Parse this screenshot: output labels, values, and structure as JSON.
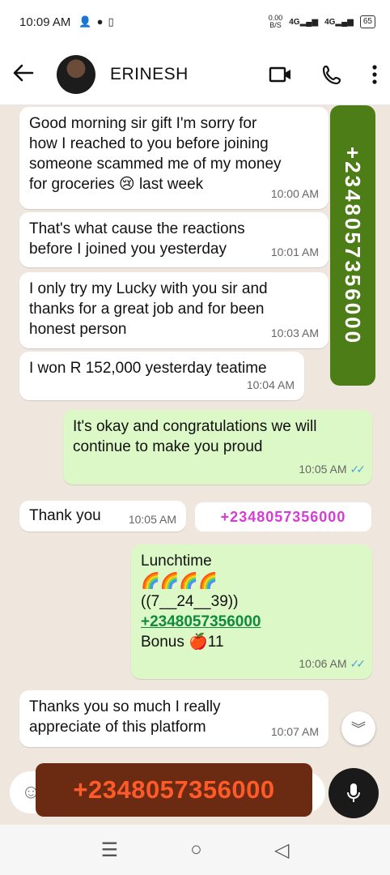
{
  "status_bar": {
    "time": "10:09 AM",
    "net_speed_value": "0.00",
    "net_speed_unit": "B/S",
    "signal1": "4G",
    "signal2": "4G",
    "battery": "65"
  },
  "header": {
    "contact_name": "ERINESH"
  },
  "messages": [
    {
      "dir": "in",
      "text": "Good morning sir gift I'm sorry for\nhow I reached to you before  joining\nsomeone scammed me of my money\nfor groceries 😢 last week",
      "time": "10:00 AM"
    },
    {
      "dir": "in",
      "text": "That's what cause the reactions\nbefore I joined you yesterday",
      "time": "10:01 AM"
    },
    {
      "dir": "in",
      "text": "I only try my Lucky with you sir and\nthanks for a great job and for been\nhonest person",
      "time": "10:03 AM"
    },
    {
      "dir": "in",
      "text": "I won R 152,000 yesterday teatime",
      "time": "10:04 AM"
    },
    {
      "dir": "out",
      "text": "It's okay and congratulations we will\ncontinue to make you proud",
      "time": "10:05 AM"
    },
    {
      "dir": "in",
      "text": "Thank you",
      "time": "10:05 AM"
    },
    {
      "dir": "out",
      "line1": "Lunchtime",
      "line2": "🌈🌈🌈🌈",
      "line3": "((7__24__39))",
      "link": "+2348057356000",
      "line5": "Bonus 🍎11",
      "time": "10:06 AM"
    },
    {
      "dir": "in",
      "text": "Thanks you so much I really\nappreciate of this platform",
      "time": "10:07 AM"
    }
  ],
  "overlays": {
    "vertical_banner": "+2348057356000",
    "pink_tag": "+2348057356000",
    "input_banner": "+2348057356000"
  },
  "colors": {
    "incoming_bubble": "#ffffff",
    "outgoing_bubble": "#dcf8c6",
    "vertical_banner_bg": "#4d7d16",
    "input_banner_bg": "#6b2a12",
    "input_banner_text": "#ff5a2a",
    "pink_tag_text": "#d63bd6",
    "read_ticks": "#4fa3e0"
  },
  "icons": {
    "back": "arrow-left-icon",
    "video": "video-call-icon",
    "phone": "phone-icon",
    "menu": "more-vert-icon",
    "emoji": "emoji-icon",
    "mic": "mic-icon",
    "scroll": "chevron-double-down-icon",
    "nav_menu": "recents-icon",
    "nav_home": "home-icon",
    "nav_back": "back-triangle-icon"
  }
}
